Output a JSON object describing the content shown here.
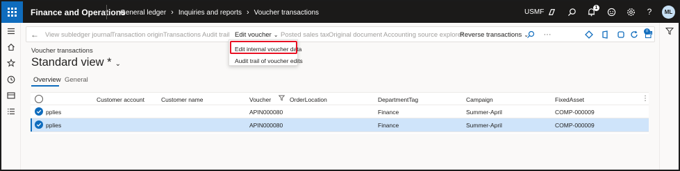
{
  "topbar": {
    "app_title": "Finance and Operations",
    "breadcrumbs": [
      "General ledger",
      "Inquiries and reports",
      "Voucher transactions"
    ],
    "company": "USMF",
    "notification_count": "1",
    "avatar_initials": "ML",
    "icons": [
      "app-launcher-icon",
      "copilot-icon",
      "search-icon",
      "bell-icon",
      "smiley-icon",
      "gear-icon",
      "help-icon"
    ]
  },
  "leftnav": {
    "icons": [
      "hamburger-icon",
      "home-icon",
      "star-icon",
      "clock-icon",
      "modules-icon",
      "list-icon"
    ]
  },
  "actionbar": {
    "items": [
      {
        "label": "View subledger journal",
        "enabled": false
      },
      {
        "label": "Transaction origin",
        "enabled": false
      },
      {
        "label": "Transactions",
        "enabled": false
      },
      {
        "label": "Audit trail",
        "enabled": false
      },
      {
        "label": "Edit voucher",
        "enabled": true,
        "dropdown": true
      },
      {
        "label": "Posted sales tax",
        "enabled": false
      },
      {
        "label": "Original document",
        "enabled": false
      },
      {
        "label": "Accounting source explorer",
        "enabled": false
      },
      {
        "label": "Reverse transactions",
        "enabled": true,
        "dropdown": true
      }
    ],
    "office_badge": "0"
  },
  "edit_voucher_menu": {
    "items": [
      "Edit internal voucher data",
      "Audit trail of voucher edits"
    ],
    "highlighted": "Edit internal voucher data"
  },
  "page": {
    "caption": "Voucher transactions",
    "view_title": "Standard view *",
    "tabs": [
      "Overview",
      "General"
    ],
    "selected_tab": "Overview"
  },
  "grid": {
    "columns": [
      "Customer account",
      "Customer name",
      "Voucher",
      "OrderLocation",
      "DepartmentTag",
      "Campaign",
      "FixedAsset"
    ],
    "rows": [
      {
        "first": "pplies",
        "customer_account": "",
        "customer_name": "",
        "voucher": "APIN000080",
        "order_location": "",
        "department": "Finance",
        "campaign": "Summer-April",
        "fixed_asset": "COMP-000009",
        "selected": true
      },
      {
        "first": "pplies",
        "customer_account": "",
        "customer_name": "",
        "voucher": "APIN000080",
        "order_location": "",
        "department": "Finance",
        "campaign": "Summer-April",
        "fixed_asset": "COMP-000009",
        "selected": true
      }
    ]
  },
  "colors": {
    "topbar": "#1b1a19",
    "accent": "#0f6cbd",
    "selected_row": "#cfe4fa",
    "highlight_box": "#e81123"
  }
}
